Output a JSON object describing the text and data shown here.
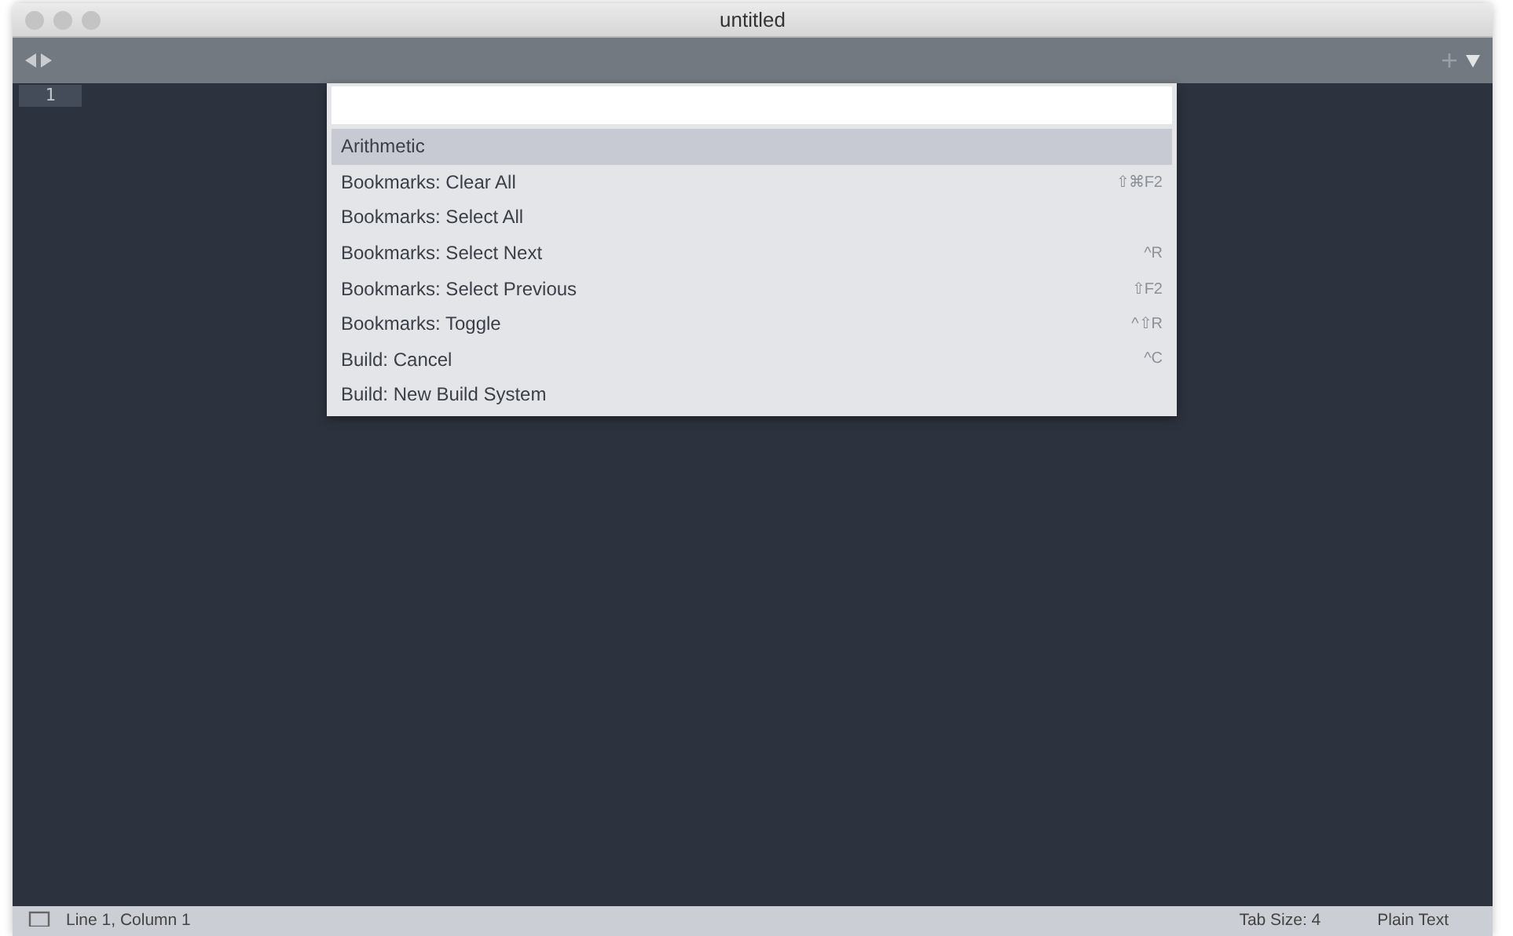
{
  "window": {
    "title": "untitled"
  },
  "gutter": {
    "line_numbers": [
      "1"
    ]
  },
  "palette": {
    "items": [
      {
        "label": "Arithmetic",
        "selected": true
      },
      {
        "label": "Bookmarks: Clear All",
        "shortcut": "⇧⌘F2",
        "selected": false
      },
      {
        "label": "Bookmarks: Select All",
        "selected": false
      },
      {
        "label": "Bookmarks: Select Next",
        "shortcut": "^R",
        "selected": false
      },
      {
        "label": "Bookmarks: Select Previous",
        "shortcut": "⇧F2",
        "selected": false
      },
      {
        "label": "Bookmarks: Toggle",
        "shortcut": "^⇧R",
        "selected": false
      },
      {
        "label": "Build: Cancel",
        "shortcut": "^C",
        "selected": false
      },
      {
        "label": "Build: New Build System",
        "selected": false
      }
    ]
  },
  "status_bar": {
    "position": "Line 1, Column 1",
    "tab_size": "Tab Size: 4",
    "syntax": "Plain Text"
  }
}
